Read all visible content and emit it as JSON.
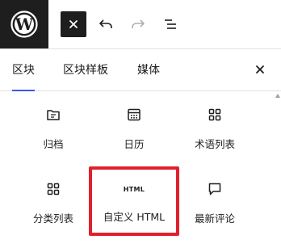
{
  "toolbar": {
    "logo": "wordpress-logo",
    "close_toggle_icon": "close-icon",
    "undo_icon": "undo-icon",
    "redo_icon": "redo-icon",
    "list_view_icon": "list-view-icon"
  },
  "tabs": [
    {
      "label": "区块",
      "active": true
    },
    {
      "label": "区块样板",
      "active": false
    },
    {
      "label": "媒体",
      "active": false
    }
  ],
  "blocks": [
    {
      "label": "归档",
      "icon": "archive-folder-icon"
    },
    {
      "label": "日历",
      "icon": "calendar-icon"
    },
    {
      "label": "术语列表",
      "icon": "grid-icon"
    },
    {
      "label": "分类列表",
      "icon": "grid-icon"
    },
    {
      "label": "自定义 HTML",
      "icon": "html-icon",
      "icon_text": "HTML",
      "highlighted": true
    },
    {
      "label": "最新评论",
      "icon": "comment-icon"
    }
  ],
  "colors": {
    "accent": "#3858e9",
    "highlight": "#e0202e",
    "dark": "#1e1e1e"
  }
}
